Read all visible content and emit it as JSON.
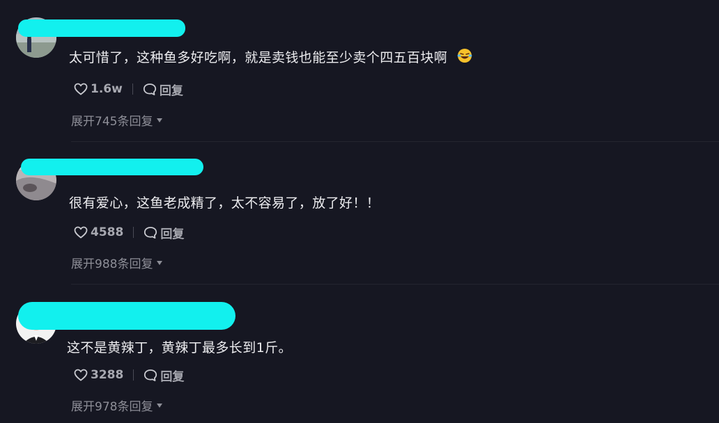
{
  "comments": [
    {
      "text": "太可惜了，这种鱼多好吃啊，就是卖钱也能至少卖个四五百块啊",
      "emoji": "laughing-crying-emoji",
      "likes": "1.6w",
      "reply_label": "回复",
      "expand_label": "展开745条回复"
    },
    {
      "text": "很有爱心，这鱼老成精了，太不容易了，放了好！！",
      "likes": "4588",
      "reply_label": "回复",
      "expand_label": "展开988条回复"
    },
    {
      "text": "这不是黄辣丁，黄辣丁最多长到1斤。",
      "likes": "3288",
      "reply_label": "回复",
      "expand_label": "展开978条回复"
    }
  ],
  "icons": [
    "heart-icon",
    "comment-bubble-icon",
    "caret-down-icon"
  ],
  "colors": {
    "background": "#161722",
    "redaction": "#12f0ee",
    "text": "#ececef",
    "muted": "#8d8e97"
  }
}
